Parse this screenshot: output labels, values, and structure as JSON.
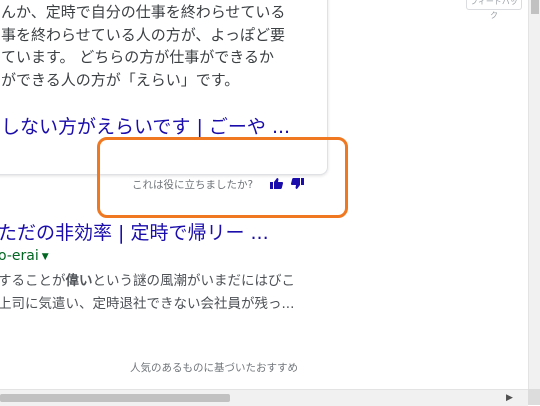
{
  "snippet": {
    "lines": [
      "んか、定時で自分の仕事を終わらせている",
      "事を終わらせている人の方が、よっぽど要",
      "ています。 どちらの方が仕事ができるか",
      "ができる人の方が「えらい」です。"
    ],
    "link": "しない方がえらいです | ごーや ..."
  },
  "topright_tag": "フィードバック",
  "feedback": {
    "question": "これは役に立ちましたか?",
    "thumb_up_icon": "thumbs-up-icon",
    "thumb_down_icon": "thumbs-down-icon",
    "icon_color": "#1a0dab"
  },
  "highlight_color": "#f07820",
  "result": {
    "title": "ただの非効率 | 定時で帰リー ...",
    "url": "o-erai",
    "snippet_line1_pre": "することが",
    "snippet_line1_bold": "偉い",
    "snippet_line1_post": "という謎の風潮がいまだにはびこ",
    "snippet_line2": "上司に気遣い、定時退社できない会社員が残っ..."
  },
  "footer": {
    "note": "人気のあるものに基づいたおすすめ"
  },
  "scrollbar": {
    "left_arrow": "◀",
    "right_arrow": "▶"
  }
}
